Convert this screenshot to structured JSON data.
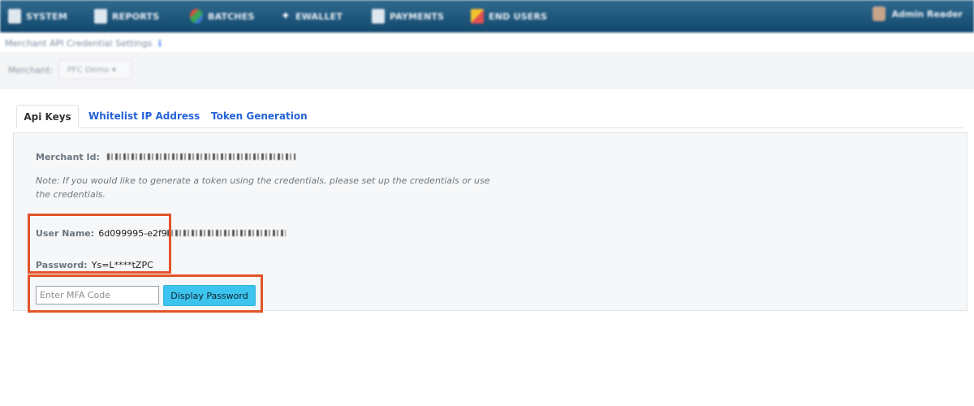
{
  "nav": {
    "items": [
      {
        "label": "SYSTEM",
        "icon": "system-icon"
      },
      {
        "label": "REPORTS",
        "icon": "reports-icon"
      },
      {
        "label": "BATCHES",
        "icon": "batches-icon"
      },
      {
        "label": "EWALLET",
        "icon": "star-icon"
      },
      {
        "label": "PAYMENTS",
        "icon": "payments-icon"
      },
      {
        "label": "END USERS",
        "icon": "puzzle-icon"
      }
    ],
    "user": "Admin Reader"
  },
  "page": {
    "title": "Merchant API Credential Settings",
    "info_glyph": "ℹ"
  },
  "merchant": {
    "label": "Merchant:",
    "selected": "PFC Demo"
  },
  "tabs": [
    {
      "label": "Api Keys",
      "active": true
    },
    {
      "label": "Whitelist IP Address",
      "active": false
    },
    {
      "label": "Token Generation",
      "active": false
    }
  ],
  "credentials": {
    "merchant_id_label": "Merchant Id:",
    "note": "Note: If you would like to generate a token using the credentials, please set up the credentials or use the credentials.",
    "username_label": "User Name:",
    "username_visible": "6d099995-e2f9",
    "password_label": "Password:",
    "password_value": "Ys=L****tZPC"
  },
  "mfa": {
    "placeholder": "Enter MFA Code",
    "value": "",
    "button_label": "Display Password"
  },
  "colors": {
    "nav_bg": "#1e557c",
    "link": "#2563d8",
    "highlight": "#e3532a",
    "button": "#3cc3ee"
  }
}
